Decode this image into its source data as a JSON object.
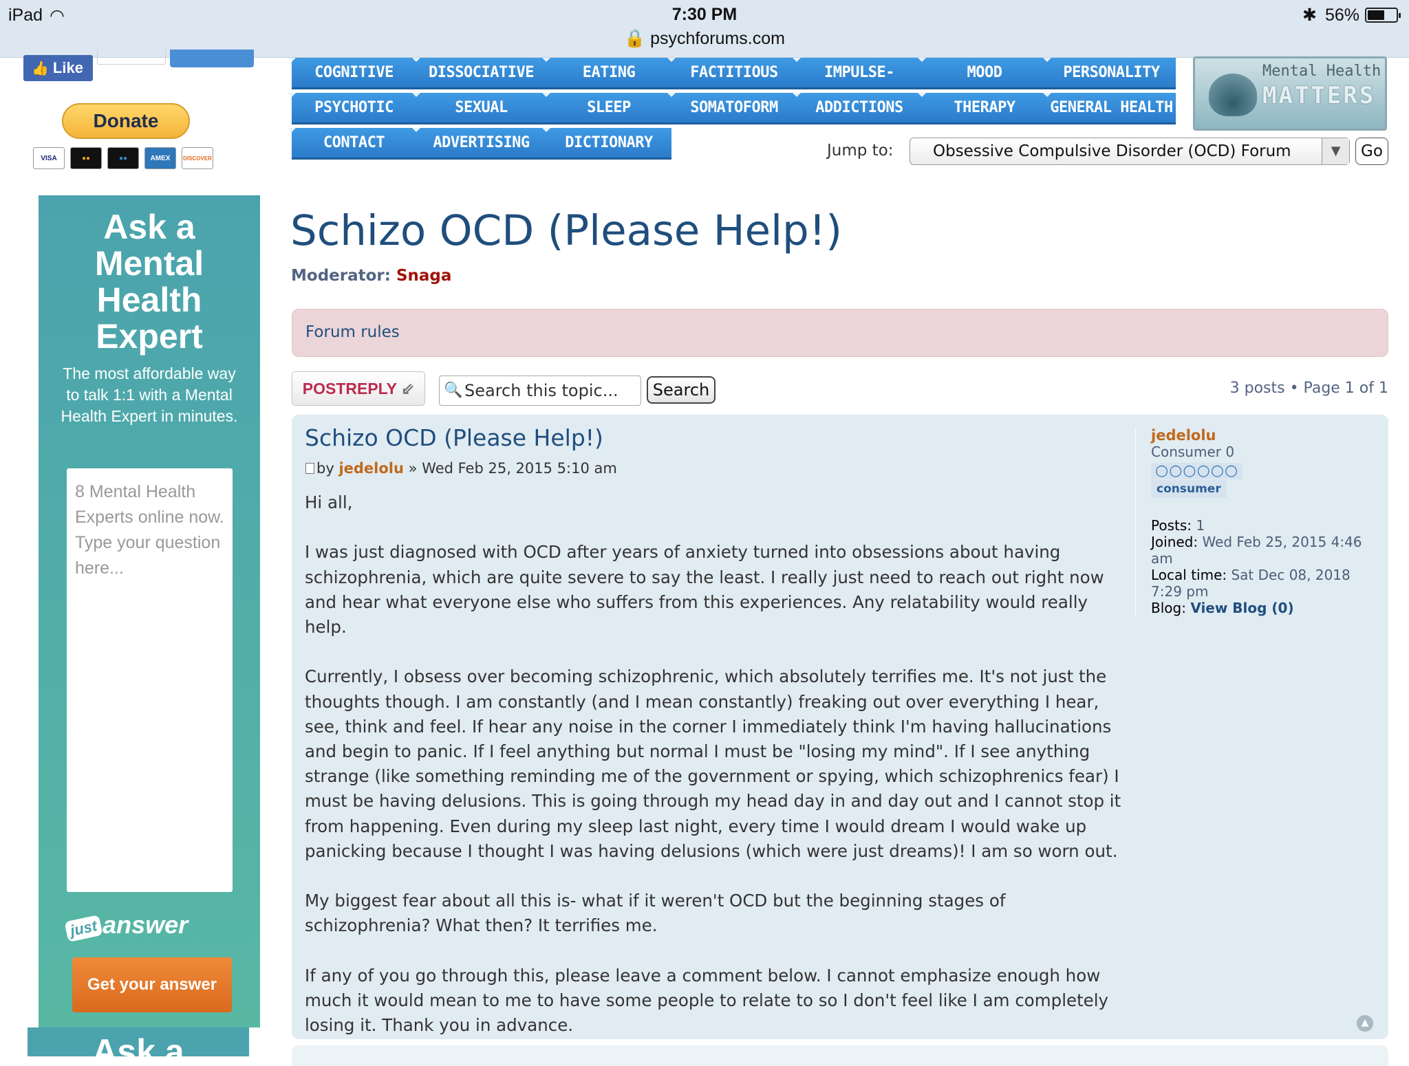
{
  "status_bar": {
    "device": "iPad",
    "time": "7:30 PM",
    "url": "psychforums.com",
    "battery_percent": "56%",
    "battery_level": 0.56
  },
  "social": {
    "like_label": "Like"
  },
  "donate": {
    "label": "Donate",
    "cards": [
      "VISA",
      "MC",
      "MAESTRO",
      "AMEX",
      "DISCOVER"
    ]
  },
  "ad": {
    "title_lines": [
      "Ask a",
      "Mental",
      "Health",
      "Expert"
    ],
    "subtitle": "The most affordable way to talk 1:1 with a Mental Health Expert in minutes.",
    "input_placeholder": "8 Mental Health Experts online now. Type your question here...",
    "logo_just": "just",
    "logo_answer": "answer",
    "cta": "Get your answer",
    "second_title": "Ask a"
  },
  "nav": {
    "row1": [
      "COGNITIVE",
      "DISSOCIATIVE",
      "EATING",
      "FACTITIOUS",
      "IMPULSE-CONTROL",
      "MOOD",
      "PERSONALITY"
    ],
    "row2": [
      "PSYCHOTIC",
      "SEXUAL",
      "SLEEP",
      "SOMATOFORM",
      "ADDICTIONS",
      "THERAPY",
      "GENERAL HEALTH"
    ],
    "row3": [
      "CONTACT",
      "ADVERTISING",
      "DICTIONARY"
    ]
  },
  "logo": {
    "line1": "Mental Health",
    "line2": "MATTERS"
  },
  "jump": {
    "label": "Jump to:",
    "selected": "Obsessive Compulsive Disorder (OCD) Forum",
    "go_label": "Go"
  },
  "topic": {
    "title": "Schizo OCD (Please Help!)",
    "moderator_label": "Moderator:",
    "moderator_name": "Snaga",
    "rules_link": "Forum rules"
  },
  "actions": {
    "post_reply": "POSTREPLY",
    "search_placeholder": "Search this topic...",
    "search_button": "Search",
    "pagination": "3 posts • Page 1 of 1"
  },
  "post": {
    "title": "Schizo OCD (Please Help!)",
    "by": "by",
    "author": "jedelolu",
    "date": "» Wed Feb 25, 2015 5:10 am",
    "paragraphs": [
      "Hi all,",
      "I was just diagnosed with OCD after years of anxiety turned into obsessions about having schizophrenia, which are quite severe to say the least. I really just need to reach out right now and hear what everyone else who suffers from this experiences. Any relatability would really help.",
      "Currently, I obsess over becoming schizophrenic, which absolutely terrifies me. It's not just the thoughts though. I am constantly (and I mean constantly) freaking out over everything I hear, see, think and feel. If hear any noise in the corner I immediately think I'm having hallucinations and begin to panic. If I feel anything but normal I must be \"losing my mind\". If I see anything strange (like something reminding me of the government or spying, which schizophrenics fear) I must be having delusions. This is going through my head day in and day out and I cannot stop it from happening. Even during my sleep last night, every time I would dream I would wake up panicking because I thought I was having delusions (which were just dreams)! I am so worn out.",
      "My biggest fear about all this is- what if it weren't OCD but the beginning stages of schizophrenia? What then? It terrifies me.",
      "If any of you go through this, please leave a comment below. I cannot emphasize enough how much it would mean to me to have some people to relate to so I don't feel like I am completely losing it. Thank you in advance."
    ]
  },
  "profile": {
    "name": "jedelolu",
    "rank": "Consumer 0",
    "rank_dots": "○○○○○○",
    "badge": "consumer",
    "posts_label": "Posts:",
    "posts": "1",
    "joined_label": "Joined:",
    "joined": "Wed Feb 25, 2015 4:46 am",
    "local_time_label": "Local time:",
    "local_time": "Sat Dec 08, 2018 7:29 pm",
    "blog_label": "Blog:",
    "blog_link": "View Blog (0)"
  }
}
